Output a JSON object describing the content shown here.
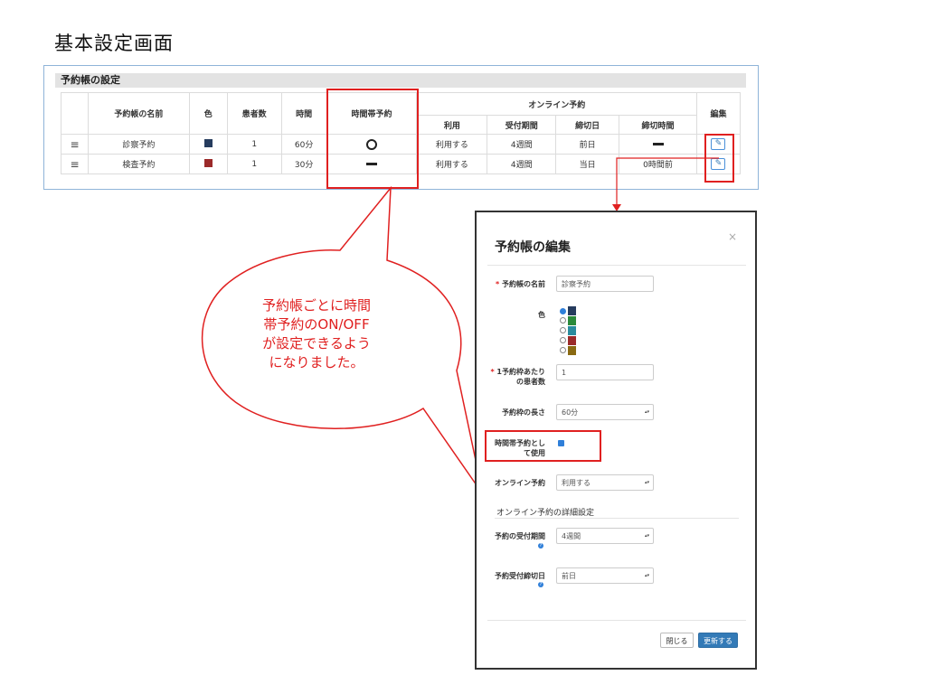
{
  "page_title": "基本設定画面",
  "table": {
    "panel_title": "予約帳の設定",
    "headers": {
      "name": "予約帳の名前",
      "color": "色",
      "patients": "患者数",
      "time": "時間",
      "timeslot": "時間帯予約",
      "online_group": "オンライン予約",
      "edit": "編集",
      "use": "利用",
      "period": "受付期間",
      "deadline_day": "締切日",
      "deadline_time": "締切時間"
    },
    "rows": [
      {
        "name": "診察予約",
        "color": "#263c5e",
        "patients": "1",
        "time": "60分",
        "timeslot_icon": "circle-icon",
        "use": "利用する",
        "period": "4週間",
        "deadline_day": "前日",
        "deadline_time_icon": "dash-icon",
        "deadline_time": ""
      },
      {
        "name": "検査予約",
        "color": "#9b2a2a",
        "patients": "1",
        "time": "30分",
        "timeslot_icon": "dash-icon",
        "use": "利用する",
        "period": "4週間",
        "deadline_day": "当日",
        "deadline_time": "0時間前"
      }
    ],
    "edit_icon": "pencil-square-icon",
    "drag_icon": "hamburger-icon"
  },
  "modal": {
    "title": "予約帳の編集",
    "close": "×",
    "name_label": "予約帳の名前",
    "name_value": "診察予約",
    "color_label": "色",
    "color_options": [
      "#263c5e",
      "#2b8a3a",
      "#2a8c9e",
      "#9b2a2a",
      "#8a6a12"
    ],
    "patients_label_1": "1予約枠あたり",
    "patients_label_2": "の患者数",
    "patients_value": "1",
    "length_label": "予約枠の長さ",
    "length_value": "60分",
    "timeslot_label_1": "時間帯予約とし",
    "timeslot_label_2": "て使用",
    "timeslot_checked": true,
    "online_label": "オンライン予約",
    "online_value": "利用する",
    "detail_section": "オンライン予約の詳細設定",
    "period_label": "予約の受付期間",
    "period_value": "4週間",
    "deadline_label": "予約受付締切日",
    "deadline_value": "前日",
    "btn_close": "閉じる",
    "btn_update": "更新する"
  },
  "callout": {
    "lines": [
      "予約帳ごとに時間",
      "帯予約のON/OFF",
      "が設定できるよう",
      "になりました。"
    ]
  },
  "colors": {
    "accent": "#e02020",
    "primary": "#337ab7"
  }
}
